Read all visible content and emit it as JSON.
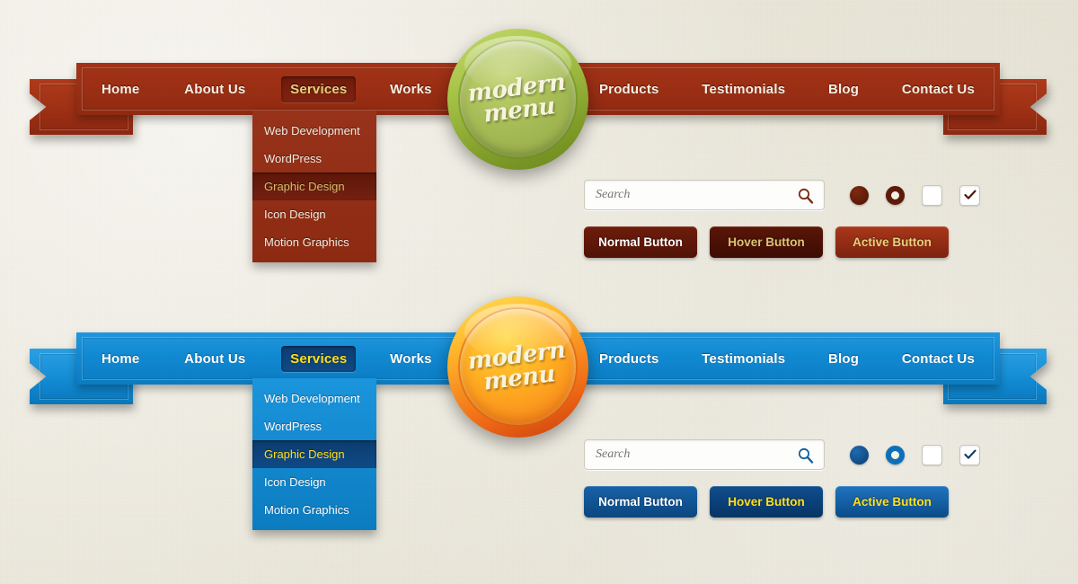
{
  "page": {
    "background_color": "#eae7d9"
  },
  "menus": [
    {
      "theme": "red",
      "accent_color": "#9c2f14",
      "badge": {
        "line1": "modern",
        "line2": "menu",
        "color_top": "#c3d86a",
        "color_bottom": "#6b861f"
      },
      "nav_items": [
        {
          "label": "Home",
          "state": "normal"
        },
        {
          "label": "About Us",
          "state": "normal"
        },
        {
          "label": "Services",
          "state": "active"
        },
        {
          "label": "Works",
          "state": "normal"
        },
        {
          "label": "Products",
          "state": "normal"
        },
        {
          "label": "Testimonials",
          "state": "normal"
        },
        {
          "label": "Blog",
          "state": "normal"
        },
        {
          "label": "Contact Us",
          "state": "normal"
        }
      ],
      "dropdown": {
        "items": [
          {
            "label": "Web Development",
            "selected": false
          },
          {
            "label": "WordPress",
            "selected": false
          },
          {
            "label": "Graphic Design",
            "selected": true
          },
          {
            "label": "Icon Design",
            "selected": false
          },
          {
            "label": "Motion Graphics",
            "selected": false
          }
        ]
      },
      "search": {
        "value": "",
        "placeholder": "Search",
        "icon": "search-icon"
      },
      "controls": {
        "radio_filled_color": "#5c1a09",
        "radio_ring_color": "#5c1a09",
        "checkbox_unchecked": false,
        "checkbox_checked": true,
        "check_color": "#4a1506"
      },
      "buttons": [
        {
          "label": "Normal Button",
          "state": "normal"
        },
        {
          "label": "Hover Button",
          "state": "hover"
        },
        {
          "label": "Active Button",
          "state": "active"
        }
      ]
    },
    {
      "theme": "blue",
      "accent_color": "#1189d2",
      "badge": {
        "line1": "modern",
        "line2": "menu",
        "color_top": "#ffe259",
        "color_bottom": "#c83d0b"
      },
      "nav_items": [
        {
          "label": "Home",
          "state": "normal"
        },
        {
          "label": "About Us",
          "state": "normal"
        },
        {
          "label": "Services",
          "state": "active"
        },
        {
          "label": "Works",
          "state": "normal"
        },
        {
          "label": "Products",
          "state": "normal"
        },
        {
          "label": "Testimonials",
          "state": "normal"
        },
        {
          "label": "Blog",
          "state": "normal"
        },
        {
          "label": "Contact Us",
          "state": "normal"
        }
      ],
      "dropdown": {
        "items": [
          {
            "label": "Web Development",
            "selected": false
          },
          {
            "label": "WordPress",
            "selected": false
          },
          {
            "label": "Graphic Design",
            "selected": true
          },
          {
            "label": "Icon Design",
            "selected": false
          },
          {
            "label": "Motion Graphics",
            "selected": false
          }
        ]
      },
      "search": {
        "value": "",
        "placeholder": "Search",
        "icon": "search-icon"
      },
      "controls": {
        "radio_filled_color": "#0d4b86",
        "radio_ring_color": "#0d6fb8",
        "checkbox_unchecked": false,
        "checkbox_checked": true,
        "check_color": "#123a63"
      },
      "buttons": [
        {
          "label": "Normal Button",
          "state": "normal"
        },
        {
          "label": "Hover Button",
          "state": "hover"
        },
        {
          "label": "Active Button",
          "state": "active"
        }
      ]
    }
  ]
}
